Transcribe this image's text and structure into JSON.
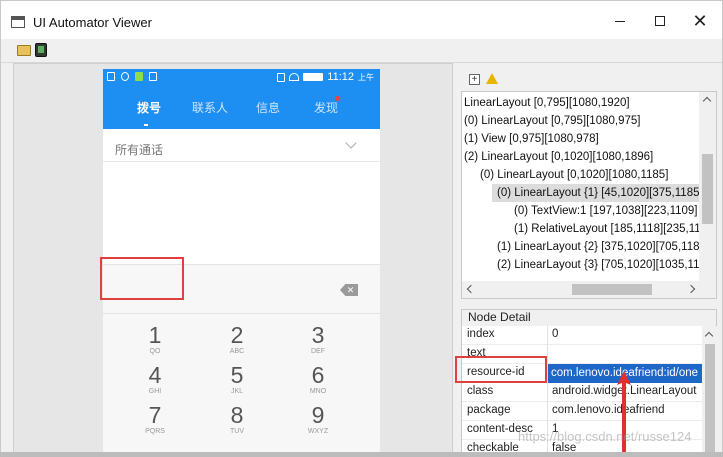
{
  "window": {
    "title": "UI Automator Viewer",
    "icon": "app-window-icon",
    "controls": [
      "minimize-icon",
      "maximize-icon",
      "close-icon"
    ]
  },
  "toolbar": {
    "icons": [
      "open-folder-icon",
      "device-screenshot-icon"
    ]
  },
  "phone": {
    "status": {
      "time": "11:12",
      "ampm": "上午"
    },
    "tabs": [
      {
        "label": "拨号",
        "active": true
      },
      {
        "label": "联系人",
        "active": false
      },
      {
        "label": "信息",
        "active": false
      },
      {
        "label": "发现",
        "active": false,
        "badge": true
      }
    ],
    "calls_header": "所有通话",
    "delete_key": "✕",
    "keys": [
      {
        "num": "1",
        "sub": "QO"
      },
      {
        "num": "2",
        "sub": "ABC"
      },
      {
        "num": "3",
        "sub": "DEF"
      },
      {
        "num": "4",
        "sub": "GHI"
      },
      {
        "num": "5",
        "sub": "JKL"
      },
      {
        "num": "6",
        "sub": "MNO"
      },
      {
        "num": "7",
        "sub": "PQRS"
      },
      {
        "num": "8",
        "sub": "TUV"
      },
      {
        "num": "9",
        "sub": "WXYZ"
      }
    ]
  },
  "tree": {
    "rows": [
      {
        "text": "LinearLayout [0,795][1080,1920]",
        "selected": false
      },
      {
        "text": "(0) LinearLayout [0,795][1080,975]",
        "selected": false
      },
      {
        "text": "(1) View [0,975][1080,978]",
        "selected": false
      },
      {
        "text": "(2) LinearLayout [0,1020][1080,1896]",
        "selected": false
      },
      {
        "text": "(0) LinearLayout [0,1020][1080,1185]",
        "selected": false
      },
      {
        "text": "(0) LinearLayout {1} [45,1020][375,1185]",
        "selected": true
      },
      {
        "text": "(0) TextView:1 [197,1038][223,1109]",
        "selected": false
      },
      {
        "text": "(1) RelativeLayout [185,1118][235,11",
        "selected": false
      },
      {
        "text": "(1) LinearLayout {2} [375,1020][705,118",
        "selected": false
      },
      {
        "text": "(2) LinearLayout {3} [705,1020][1035,11",
        "selected": false
      }
    ]
  },
  "node_detail": {
    "title": "Node Detail",
    "rows": [
      {
        "key": "index",
        "value": "0"
      },
      {
        "key": "text",
        "value": ""
      },
      {
        "key": "resource-id",
        "value": "com.lenovo.ideafriend:id/one",
        "selected": true
      },
      {
        "key": "class",
        "value": "android.widget.LinearLayout"
      },
      {
        "key": "package",
        "value": "com.lenovo.ideafriend"
      },
      {
        "key": "content-desc",
        "value": "1"
      },
      {
        "key": "checkable",
        "value": "false"
      }
    ]
  },
  "watermark": "https://blog.csdn.net/russe124",
  "colors": {
    "phone_accent": "#1d8ef2",
    "highlight": "#e04040",
    "selection": "#1e66c8"
  }
}
